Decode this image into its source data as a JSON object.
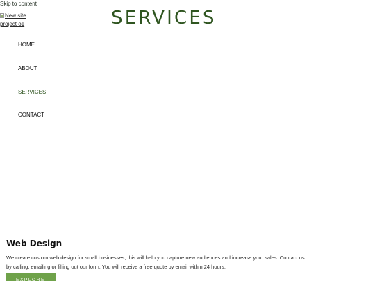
{
  "skip_link": "Skip to content",
  "logo": {
    "alt_text": "New site project o1"
  },
  "page_title": "SERVICES",
  "nav": {
    "items": [
      {
        "label": "HOME",
        "active": false
      },
      {
        "label": "ABOUT",
        "active": false
      },
      {
        "label": "SERVICES",
        "active": true
      },
      {
        "label": "CONTACT",
        "active": false
      }
    ]
  },
  "service": {
    "title": "Web Design",
    "description": "We create custom web design for small businesses, this will help you capture new audiences and increase your sales. Contact us by calling, emailing or filling out our form. You will receive a free quote by email within 24 hours.",
    "button_label": "EXPLORE"
  },
  "colors": {
    "brand_green": "#2f5520",
    "button_green": "#6fa24a",
    "text_dark": "#111111"
  }
}
